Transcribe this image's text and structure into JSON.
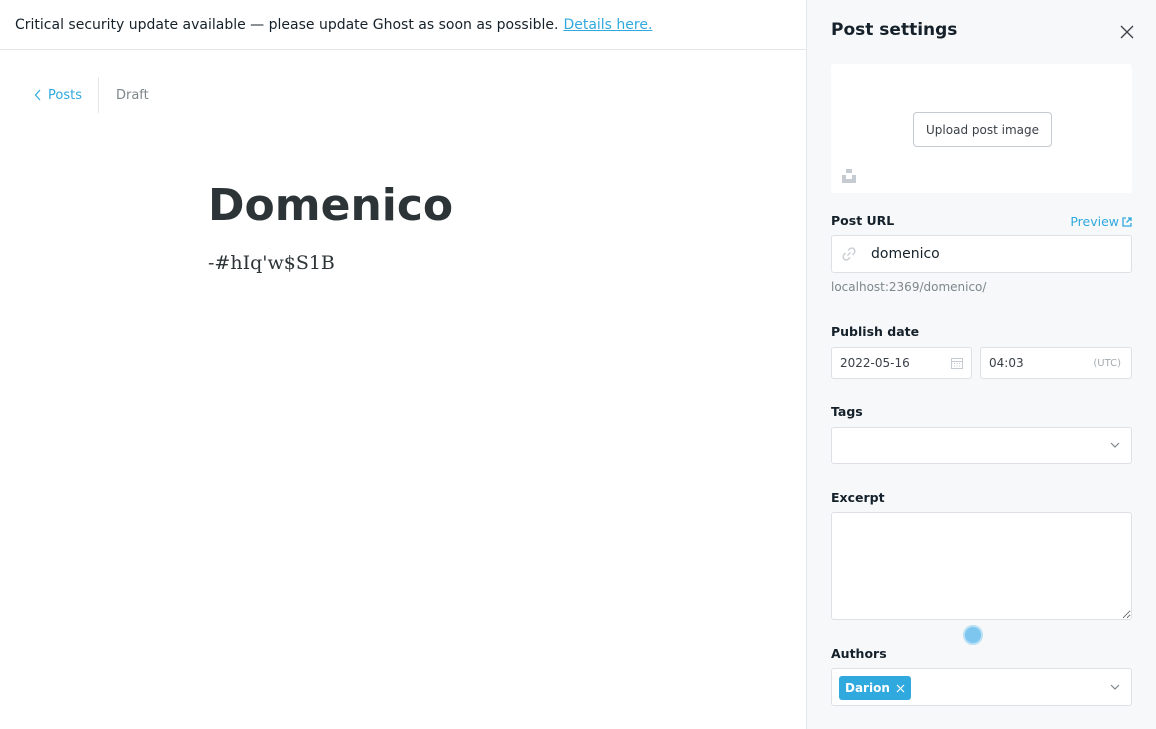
{
  "banner": {
    "message": "Critical security update available — please update Ghost as soon as possible.",
    "link_label": "Details here."
  },
  "breadcrumb": {
    "back_label": "Posts",
    "status": "Draft"
  },
  "post": {
    "title": "Domenico",
    "body": "-#hIq'w$S1B"
  },
  "settings": {
    "title": "Post settings",
    "upload_label": "Upload post image",
    "post_url_label": "Post URL",
    "preview_label": "Preview",
    "slug": "domenico",
    "url_hint": "localhost:2369/domenico/",
    "publish_date_label": "Publish date",
    "date": "2022-05-16",
    "time": "04:03",
    "timezone": "(UTC)",
    "tags_label": "Tags",
    "excerpt_label": "Excerpt",
    "authors_label": "Authors",
    "authors": [
      "Darion"
    ]
  },
  "colors": {
    "accent": "#30a9de",
    "text": "#15212a",
    "panel_bg": "#f7f8fa"
  }
}
